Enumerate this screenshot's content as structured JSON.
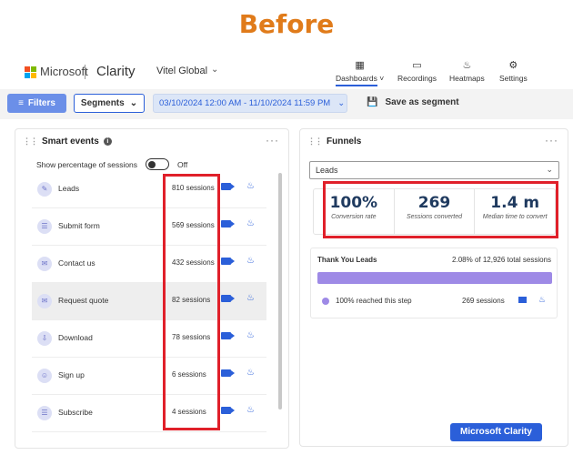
{
  "banner": "Before",
  "header": {
    "brand": "Microsoft",
    "product": "Clarity",
    "project": "Vitel Global",
    "nav": [
      {
        "label": "Dashboards",
        "icon": "dashboard-icon"
      },
      {
        "label": "Recordings",
        "icon": "video-icon"
      },
      {
        "label": "Heatmaps",
        "icon": "flame-icon"
      },
      {
        "label": "Settings",
        "icon": "gear-icon"
      }
    ]
  },
  "toolbar": {
    "filters_label": "Filters",
    "segments_label": "Segments",
    "date_range": "03/10/2024 12:00 AM - 11/10/2024 11:59 PM",
    "save_segment_label": "Save as segment"
  },
  "smart_events": {
    "title": "Smart events",
    "toggle_label": "Show percentage of sessions",
    "toggle_state": "Off",
    "items": [
      {
        "name": "Leads",
        "count": "810 sessions"
      },
      {
        "name": "Submit form",
        "count": "569 sessions"
      },
      {
        "name": "Contact us",
        "count": "432 sessions"
      },
      {
        "name": "Request quote",
        "count": "82 sessions"
      },
      {
        "name": "Download",
        "count": "78 sessions"
      },
      {
        "name": "Sign up",
        "count": "6 sessions"
      },
      {
        "name": "Subscribe",
        "count": "4 sessions"
      }
    ]
  },
  "funnels": {
    "title": "Funnels",
    "selected": "Leads",
    "stats": [
      {
        "value": "100%",
        "label": "Conversion rate"
      },
      {
        "value": "269",
        "label": "Sessions converted"
      },
      {
        "value": "1.4 m",
        "label": "Median time to convert"
      }
    ],
    "step": {
      "title": "Thank You Leads",
      "total": "2.08% of 12,926 total sessions",
      "fill_fraction": 1.0,
      "reached": "100% reached this step",
      "sessions": "269 sessions"
    }
  },
  "watermark": "Microsoft Clarity",
  "colors": {
    "accent": "#2b5fd9",
    "highlight_box": "#e0202a",
    "banner": "#e07b1a",
    "funnel_bar": "#9e8ae6"
  }
}
